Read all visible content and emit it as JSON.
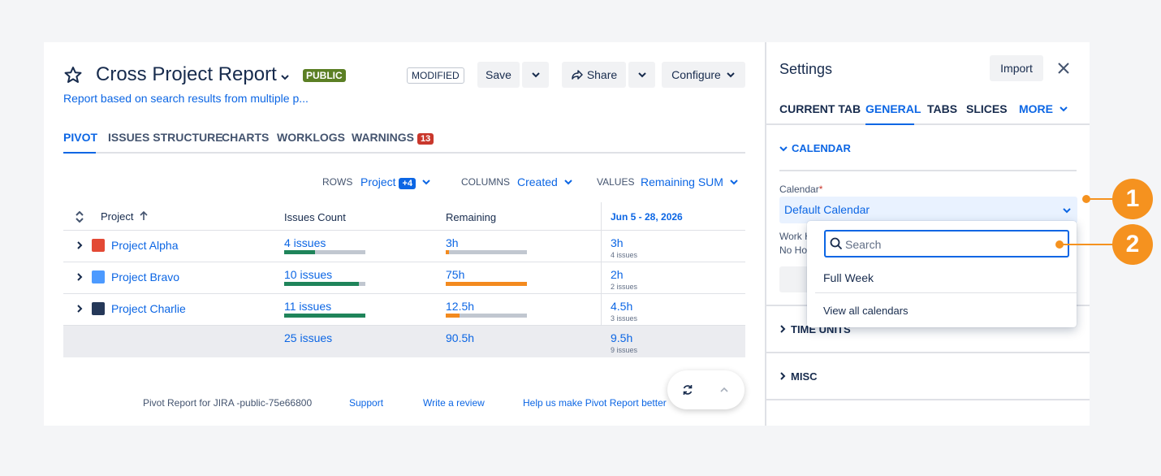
{
  "report": {
    "title": "Cross Project Report",
    "visibility": "PUBLIC",
    "status": "MODIFIED",
    "subtitle": "Report based on search results from multiple p...",
    "buttons": {
      "save": "Save",
      "share": "Share",
      "configure": "Configure"
    }
  },
  "tabs": [
    {
      "label": "PIVOT",
      "active": true
    },
    {
      "label": "ISSUES STRUCTURE"
    },
    {
      "label": "CHARTS"
    },
    {
      "label": "WORKLOGS"
    },
    {
      "label": "WARNINGS",
      "count": "13"
    }
  ],
  "config": {
    "rows_label": "ROWS",
    "rows_value": "Project",
    "rows_extra": "+4",
    "columns_label": "COLUMNS",
    "columns_value": "Created",
    "values_label": "VALUES",
    "values_value": "Remaining SUM"
  },
  "table": {
    "headers": {
      "project": "Project",
      "issues": "Issues Count",
      "remaining": "Remaining",
      "date": "Jun 5 - 28, 2026"
    },
    "rows": [
      {
        "project": "Project Alpha",
        "issues": "4 issues",
        "issues_fill": 0.38,
        "remaining": "3h",
        "remaining_fill": 0.04,
        "date_value": "3h",
        "date_issues": "4 issues"
      },
      {
        "project": "Project Bravo",
        "issues": "10 issues",
        "issues_fill": 0.92,
        "remaining": "75h",
        "remaining_fill": 1.0,
        "date_value": "2h",
        "date_issues": "2 issues"
      },
      {
        "project": "Project Charlie",
        "issues": "11 issues",
        "issues_fill": 1.0,
        "remaining": "12.5h",
        "remaining_fill": 0.17,
        "date_value": "4.5h",
        "date_issues": "3 issues"
      }
    ],
    "total": {
      "issues": "25 issues",
      "remaining": "90.5h",
      "date_value": "9.5h",
      "date_issues": "9 issues"
    }
  },
  "footer": {
    "text": "Pivot Report for JIRA -public-75e66800",
    "support": "Support",
    "review": "Write a review",
    "help": "Help us make Pivot Report better"
  },
  "settings": {
    "title": "Settings",
    "import": "Import",
    "tabs": [
      "CURRENT TAB",
      "GENERAL",
      "TABS",
      "SLICES",
      "MORE"
    ],
    "calendar_section": "CALENDAR",
    "calendar_label": "Calendar",
    "calendar_value": "Default Calendar",
    "work_label_partial": "Work H",
    "no_hours_partial": "No Ho",
    "time_units": "TIME UNITS",
    "misc": "MISC"
  },
  "dropdown": {
    "search_placeholder": "Search",
    "options": [
      "Full Week",
      "View all calendars"
    ]
  },
  "markers": [
    "1",
    "2"
  ],
  "colors": {
    "accent": "#0c66e4",
    "green": "#1f845a",
    "orange": "#f38a1e",
    "marker": "#f5921f",
    "public": "#5b7f24"
  }
}
